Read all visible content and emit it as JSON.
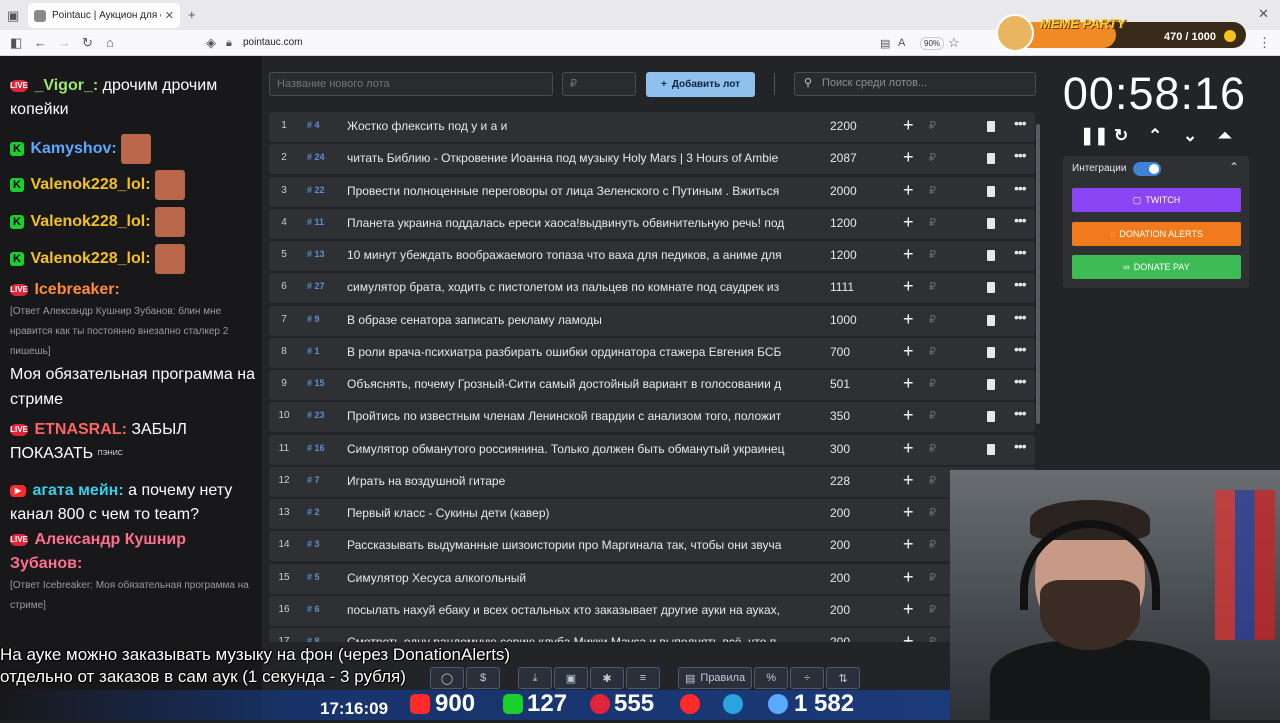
{
  "browser": {
    "tab_title": "Pointauc | Аукцион для стрима",
    "url": "pointauc.com",
    "zoom": "90%"
  },
  "meme_party": {
    "title": "MEME PARTY",
    "count": "470 / 1000"
  },
  "chat": {
    "messages": [
      {
        "user": "_Vigor_:",
        "text": "дрочим дрочим копейки"
      },
      {
        "user": "Kamyshov:"
      },
      {
        "user": "Valenok228_lol:"
      },
      {
        "user": "Valenok228_lol:"
      },
      {
        "user": "Valenok228_lol:"
      },
      {
        "user": "Icebreaker:",
        "reply": "[Ответ Александр Кушнир Зубанов: блин мне нравится как ты постоянно внезапно сталкер 2 пишешь]",
        "text": "Моя обязательная программа на стриме"
      },
      {
        "user": "ETNASRAL:",
        "text": "ЗАБЫЛ ПОКАЗАТЬ",
        "emote_label": "ПЭНИС"
      },
      {
        "user": "агата мейн:",
        "text": "а почему нету канал 800 с чем то team?"
      },
      {
        "user": "Александр Кушнир Зубанов:",
        "reply": "[Ответ Icebreaker: Моя обязательная программа на стриме]"
      }
    ]
  },
  "toolbar": {
    "new_lot_placeholder": "Название нового лота",
    "amount_placeholder": "₽",
    "add_button": "Добавить лот",
    "search_placeholder": "Поиск среди лотов..."
  },
  "lots": [
    {
      "n": "1",
      "id": "# 4",
      "name": "Жостко флексить под у и а и",
      "amount": "2200"
    },
    {
      "n": "2",
      "id": "# 24",
      "name": "читать Библию - Откровение Иоанна под музыку Holy Mars | 3 Hours of Ambie",
      "amount": "2087"
    },
    {
      "n": "3",
      "id": "# 22",
      "name": "Провести полноценные переговоры от лица Зеленского с Путиным . Вжиться",
      "amount": "2000"
    },
    {
      "n": "4",
      "id": "# 11",
      "name": "Планета украина поддалась ереси хаоса!выдвинуть обвинительную речь! под",
      "amount": "1200"
    },
    {
      "n": "5",
      "id": "# 13",
      "name": "10 минут убеждать воображаемого топаза что ваха для педиков, а аниме для",
      "amount": "1200"
    },
    {
      "n": "6",
      "id": "# 27",
      "name": "симулятор брата, ходить с пистолетом из пальцев по комнате под саудрек из",
      "amount": "1111"
    },
    {
      "n": "7",
      "id": "# 9",
      "name": "В образе сенатора записать рекламу ламоды",
      "amount": "1000"
    },
    {
      "n": "8",
      "id": "# 1",
      "name": "В роли врача-психиатра разбирать ошибки ординатора стажера Евгения БСБ",
      "amount": "700"
    },
    {
      "n": "9",
      "id": "# 15",
      "name": "Объяснять, почему Грозный-Сити самый достойный вариант в голосовании д",
      "amount": "501"
    },
    {
      "n": "10",
      "id": "# 23",
      "name": "Пройтись по известным членам Ленинской гвардии с анализом того, положит",
      "amount": "350"
    },
    {
      "n": "11",
      "id": "# 16",
      "name": "Симулятор обманутого россиянина. Только должен быть обманутый украинец",
      "amount": "300"
    },
    {
      "n": "12",
      "id": "# 7",
      "name": "Играть на воздушной гитаре",
      "amount": "228"
    },
    {
      "n": "13",
      "id": "# 2",
      "name": "Первый класс - Сукины дети (кавер)",
      "amount": "200"
    },
    {
      "n": "14",
      "id": "# 3",
      "name": "Рассказывать выдуманные шизоистории про Маргинала так, чтобы они звуча",
      "amount": "200"
    },
    {
      "n": "15",
      "id": "# 5",
      "name": "Симулятор Хесуса алкогольный",
      "amount": "200"
    },
    {
      "n": "16",
      "id": "# 6",
      "name": "посылать нахуй ебаку и всех остальных кто заказывает другие ауки на ауках,",
      "amount": "200"
    },
    {
      "n": "17",
      "id": "# 8",
      "name": "Смотреть одну рандомную серию клуба Микки Мауса и выполнять всё, что п",
      "amount": "200"
    }
  ],
  "timer": "00:58:16",
  "integrations": {
    "label": "Интеграции",
    "twitch": "TWITCH",
    "donation_alerts": "DONATION ALERTS",
    "donate_pay": "DONATE PAY"
  },
  "bottom_tools": {
    "rules": "Правила"
  },
  "caption": "На ауке можно заказывать музыку на фон (через DonationAlerts) отдельно от заказов в сам аук (1 секунда - 3 рубля)",
  "status": {
    "time": "17:16:09",
    "youtube": "900",
    "kick": "127",
    "live": "555",
    "viewers": "1 582"
  }
}
